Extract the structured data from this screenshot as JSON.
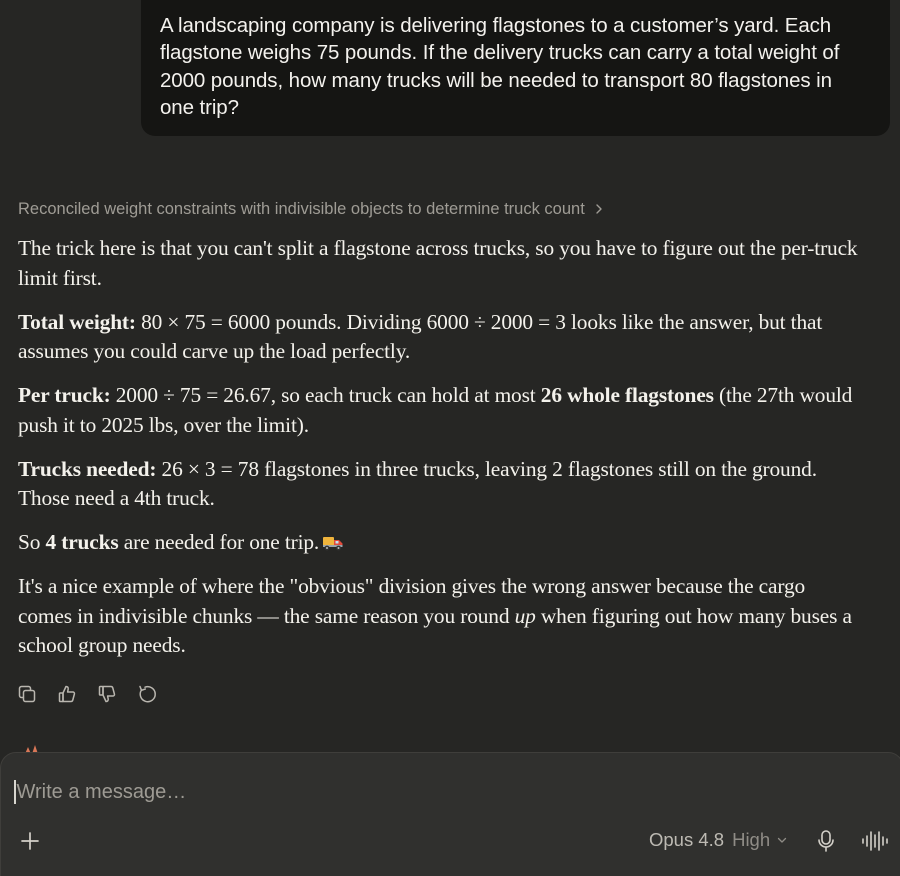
{
  "user_message": {
    "text": "A landscaping company is delivering flagstones to a customer’s yard. Each flagstone weighs 75 pounds. If the delivery trucks can carry a total weight of 2000 pounds, how many trucks will be needed to transport 80 flagstones in one trip?"
  },
  "thinking": {
    "summary": "Reconciled weight constraints with indivisible objects to determine truck count",
    "icon": "chevron-right-icon"
  },
  "response": {
    "p1": "The trick here is that you can't split a flagstone across trucks, so you have to figure out the per-truck limit first.",
    "p2_bold": "Total weight:",
    "p2_rest": " 80 × 75 = 6000 pounds. Dividing 6000 ÷ 2000 = 3 looks like the answer, but that assumes you could carve up the load perfectly.",
    "p3_bold": "Per truck:",
    "p3_mid": " 2000 ÷ 75 = 26.67, so each truck can hold at most ",
    "p3_bold2": "26 whole flagstones",
    "p3_end": " (the 27th would push it to 2025 lbs, over the limit).",
    "p4_bold": "Trucks needed:",
    "p4_rest": " 26 × 3 = 78 flagstones in three trucks, leaving 2 flagstones still on the ground. Those need a 4th truck.",
    "p5_start": "So ",
    "p5_bold": "4 trucks",
    "p5_end": " are needed for one trip.",
    "p5_emoji": "delivery-truck-icon",
    "p6_start": "It's a nice example of where the \"obvious\" division gives the wrong answer because the cargo comes in indivisible chunks — the same reason you round ",
    "p6_italic": "up",
    "p6_end": " when figuring out how many buses a school group needs."
  },
  "actions": [
    {
      "name": "copy",
      "icon": "copy-icon"
    },
    {
      "name": "thumbs-up",
      "icon": "thumbs-up-icon"
    },
    {
      "name": "thumbs-down",
      "icon": "thumbs-down-icon"
    },
    {
      "name": "retry",
      "icon": "retry-icon"
    }
  ],
  "composer": {
    "placeholder": "Write a message…",
    "model": "Opus 4.8",
    "effort": "High"
  },
  "colors": {
    "background": "#262624",
    "user_bubble": "#151513",
    "composer": "#30302e",
    "accent": "#d97757"
  }
}
